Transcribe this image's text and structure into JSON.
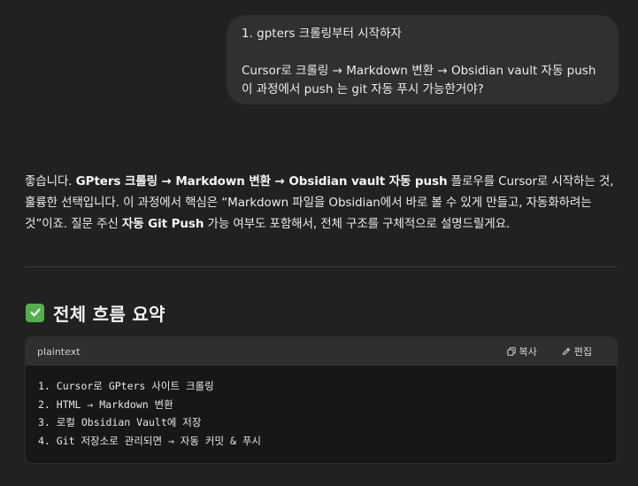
{
  "user_message": {
    "line1": "1. gpters 크롤링부터 시작하자",
    "line2": "Cursor로 크롤링 → Markdown 변환 → Obsidian vault 자동 push",
    "line3": "이 과정에서 push 는 git 자동 푸시 가능한거야?"
  },
  "reply": {
    "t1": "좋습니다. ",
    "b1": "GPters 크롤링 → Markdown 변환 → Obsidian vault 자동 push",
    "t2": " 플로우를 Cursor로 시작하는 것, 훌륭한 선택입니다. 이 과정에서 핵심은 “Markdown 파일을 Obsidian에서 바로 볼 수 있게 만들고, 자동화하려는 것”이죠. 질문 주신 ",
    "b2": "자동 Git Push",
    "t3": " 가능 여부도 포함해서, 전체 구조를 구체적으로 설명드릴게요."
  },
  "section": {
    "heading": "전체 흐름 요약",
    "icon": "check-mark-icon",
    "icon_color": "#52b04a"
  },
  "code_block": {
    "language": "plaintext",
    "copy_label": "복사",
    "edit_label": "편집",
    "lines": [
      "1. Cursor로 GPters 사이트 크롤링",
      "2. HTML → Markdown 변환",
      "3. 로컬 Obsidian Vault에 저장",
      "4. Git 저장소로 관리되면 → 자동 커밋 & 푸시"
    ]
  }
}
